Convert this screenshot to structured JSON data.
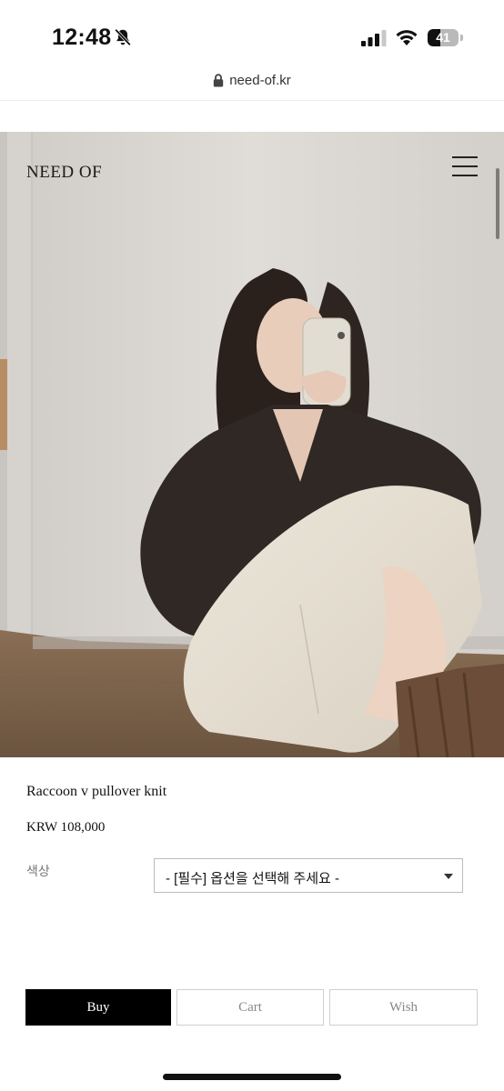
{
  "status_bar": {
    "time": "12:48",
    "battery": "41",
    "battery_level": 0.41
  },
  "browser": {
    "url": "need-of.kr"
  },
  "header": {
    "brand": "NEED OF",
    "menu_icon": "hamburger-menu-icon"
  },
  "hero": {
    "image_description": "mirror-selfie-dark-knit-white-skirt"
  },
  "product": {
    "name": "Raccoon v pullover knit",
    "price": "KRW 108,000",
    "option_label": "색상",
    "option_value": "- [필수] 옵션을 선택해 주세요 -"
  },
  "actions": {
    "buy": "Buy",
    "cart": "Cart",
    "wish": "Wish"
  },
  "colors": {
    "buy_bg": "#000000",
    "secondary_text": "#888888"
  }
}
